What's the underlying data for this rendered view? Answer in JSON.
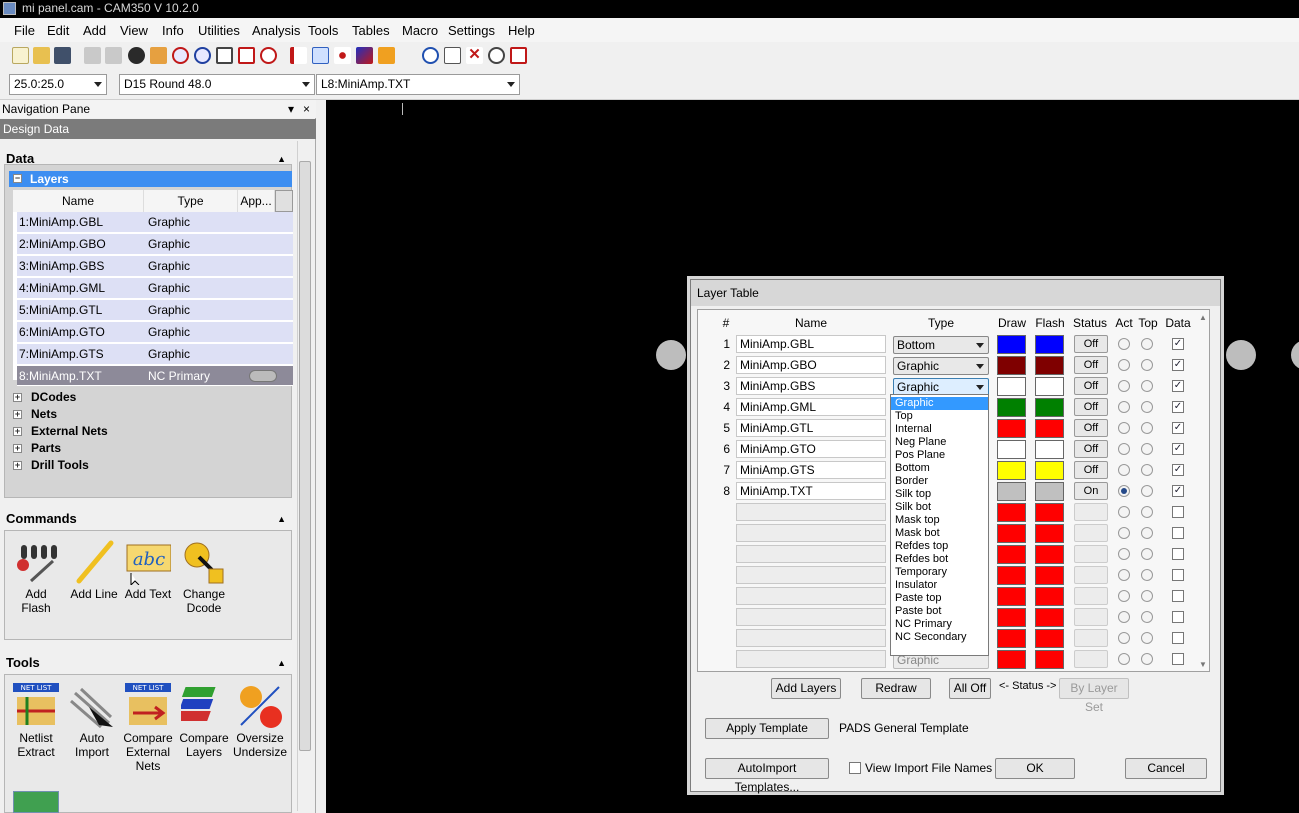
{
  "window": {
    "title": "mi panel.cam - CAM350 V 10.2.0"
  },
  "menu": [
    "File",
    "Edit",
    "Add",
    "View",
    "Info",
    "Utilities",
    "Analysis",
    "Tools",
    "Tables",
    "Macro",
    "Settings",
    "Help"
  ],
  "selectors": {
    "grid": "25.0:25.0",
    "dcode": "D15   Round 48.0",
    "layer": "L8:MiniAmp.TXT"
  },
  "nav": {
    "title": "Navigation Pane",
    "pin": "▾",
    "close": "×",
    "design_data": "Design Data",
    "data_section": "Data",
    "layers_label": "Layers",
    "layer_cols": [
      "Name",
      "Type",
      "App..."
    ],
    "layers": [
      {
        "name": "1:MiniAmp.GBL",
        "type": "Graphic"
      },
      {
        "name": "2:MiniAmp.GBO",
        "type": "Graphic"
      },
      {
        "name": "3:MiniAmp.GBS",
        "type": "Graphic"
      },
      {
        "name": "4:MiniAmp.GML",
        "type": "Graphic"
      },
      {
        "name": "5:MiniAmp.GTL",
        "type": "Graphic"
      },
      {
        "name": "6:MiniAmp.GTO",
        "type": "Graphic"
      },
      {
        "name": "7:MiniAmp.GTS",
        "type": "Graphic"
      },
      {
        "name": "8:MiniAmp.TXT",
        "type": "NC Primary"
      }
    ],
    "tree": [
      "DCodes",
      "Nets",
      "External Nets",
      "Parts",
      "Drill Tools"
    ],
    "commands_section": "Commands",
    "commands": [
      {
        "label": "Add Flash",
        "icon": "add-flash-icon"
      },
      {
        "label": "Add Line",
        "icon": "add-line-icon"
      },
      {
        "label": "Add Text",
        "icon": "add-text-icon",
        "badge": "abc"
      },
      {
        "label": "Change\nDcode",
        "icon": "change-dcode-icon"
      }
    ],
    "tools_section": "Tools",
    "netlist_badge": "NET LIST",
    "tools": [
      {
        "label": "Netlist\nExtract",
        "icon": "netlist-extract-icon"
      },
      {
        "label": "Auto\nImport",
        "icon": "auto-import-icon"
      },
      {
        "label": "Compare\nExternal\nNets",
        "icon": "compare-external-nets-icon"
      },
      {
        "label": "Compare\nLayers",
        "icon": "compare-layers-icon"
      },
      {
        "label": "Oversize\nUndersize",
        "icon": "oversize-undersize-icon"
      }
    ]
  },
  "layer_table": {
    "title": "Layer Table",
    "columns": [
      "#",
      "Name",
      "Type",
      "Draw",
      "Flash",
      "Status",
      "Act",
      "Top",
      "Data"
    ],
    "rows": [
      {
        "n": "1",
        "name": "MiniAmp.GBL",
        "type": "Bottom",
        "draw": "#0000ff",
        "flash": "#0000ff",
        "status": "Off",
        "act": false,
        "data": true
      },
      {
        "n": "2",
        "name": "MiniAmp.GBO",
        "type": "Graphic",
        "draw": "#7f0000",
        "flash": "#7f0000",
        "status": "Off",
        "act": false,
        "data": true
      },
      {
        "n": "3",
        "name": "MiniAmp.GBS",
        "type": "Graphic",
        "draw": "#ffffff",
        "flash": "#ffffff",
        "status": "Off",
        "act": false,
        "data": true
      },
      {
        "n": "4",
        "name": "MiniAmp.GML",
        "type": "",
        "draw": "#008000",
        "flash": "#008000",
        "status": "Off",
        "act": false,
        "data": true
      },
      {
        "n": "5",
        "name": "MiniAmp.GTL",
        "type": "",
        "draw": "#ff0000",
        "flash": "#ff0000",
        "status": "Off",
        "act": false,
        "data": true
      },
      {
        "n": "6",
        "name": "MiniAmp.GTO",
        "type": "",
        "draw": "#ffffff",
        "flash": "#ffffff",
        "status": "Off",
        "act": false,
        "data": true
      },
      {
        "n": "7",
        "name": "MiniAmp.GTS",
        "type": "",
        "draw": "#ffff00",
        "flash": "#ffff00",
        "status": "Off",
        "act": false,
        "data": true
      },
      {
        "n": "8",
        "name": "MiniAmp.TXT",
        "type": "",
        "draw": "#c0c0c0",
        "flash": "#c0c0c0",
        "status": "On",
        "act": true,
        "data": true
      }
    ],
    "empty_row_color": "#ff0000",
    "empty_rows": 8,
    "last_type": "Graphic",
    "dropdown_options": [
      "Graphic",
      "Top",
      "Internal",
      "Neg Plane",
      "Pos Plane",
      "Bottom",
      "Border",
      "Silk top",
      "Silk bot",
      "Mask top",
      "Mask bot",
      "Refdes top",
      "Refdes bot",
      "Temporary",
      "Insulator",
      "Paste top",
      "Paste bot",
      "NC Primary",
      "NC Secondary"
    ],
    "dropdown_selected": "Graphic",
    "buttons": {
      "add_layers": "Add Layers",
      "redraw": "Redraw",
      "all_off": "All Off",
      "status_hint": "<- Status ->",
      "by_layer_set": "By Layer Set",
      "apply_template": "Apply Template",
      "template_name": "PADS General Template",
      "autoimport_templates": "AutoImport Templates...",
      "view_import": "View Import File Names",
      "ok": "OK",
      "cancel": "Cancel"
    }
  }
}
